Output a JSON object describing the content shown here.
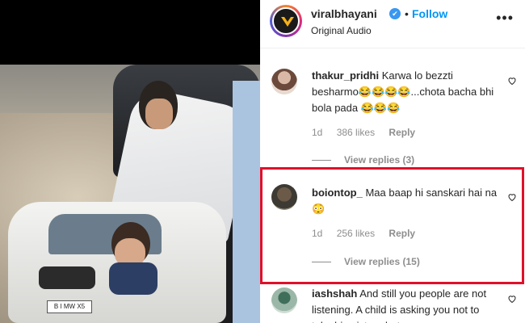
{
  "media": {
    "plate_text": "B I MW X5"
  },
  "header": {
    "username": "viralbhayani",
    "verified_symbol": "✔",
    "dot": "•",
    "follow_label": "Follow",
    "subtitle": "Original Audio",
    "more_icon": "more-horizontal-icon"
  },
  "comments": [
    {
      "username": "thakur_pridhi",
      "text": "Karwa lo bezzti besharmo😂😂😂😂...chota bacha bhi bola pada 😂😂😂",
      "time": "1d",
      "likes": "386 likes",
      "reply": "Reply",
      "view_replies": "View replies (3)"
    },
    {
      "username": "boiontop_",
      "text": "Maa baap hi sanskari hai na 😳",
      "time": "1d",
      "likes": "256 likes",
      "reply": "Reply",
      "view_replies": "View replies (15)"
    },
    {
      "username": "iashshah",
      "text": "And still you people are not listening. A child is asking you not to take his picture but you"
    }
  ],
  "colors": {
    "highlight": "#e0102a",
    "follow": "#0095f6",
    "verified": "#3897f0"
  }
}
